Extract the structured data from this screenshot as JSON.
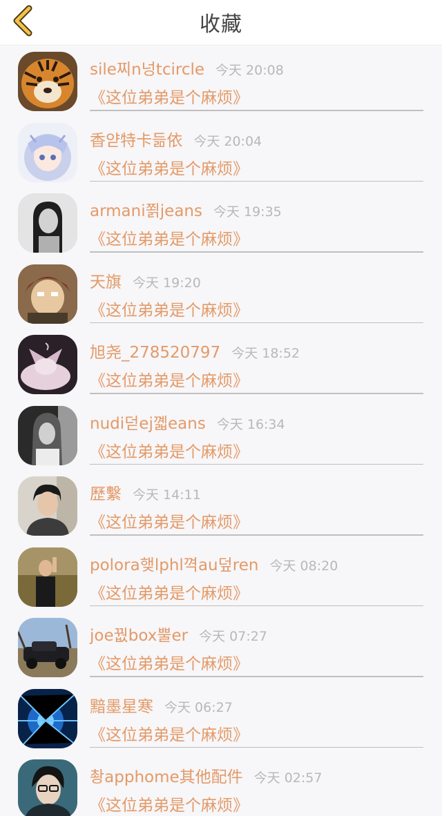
{
  "header": {
    "title": "收藏",
    "back_icon": "chevron-left-icon",
    "back_color": "#f2c14e"
  },
  "accent_color": "#e39a68",
  "items": [
    {
      "name": "sile찌n넝tcircle",
      "time": "今天 20:08",
      "book": "《这位弟弟是个麻烦》",
      "avatar": "tiger"
    },
    {
      "name": "香얃特卡듦依",
      "time": "今天 20:04",
      "book": "《这位弟弟是个麻烦》",
      "avatar": "anime-girl"
    },
    {
      "name": "armani쬙jeans",
      "time": "今天 19:35",
      "book": "《这位弟弟是个麻烦》",
      "avatar": "woman-bw"
    },
    {
      "name": "天旗",
      "time": "今天 19:20",
      "book": "《这位弟弟是个麻烦》",
      "avatar": "anime-boy"
    },
    {
      "name": "旭尧_278520797",
      "time": "今天 18:52",
      "book": "《这位弟弟是个麻烦》",
      "avatar": "anime-cat"
    },
    {
      "name": "nudi덛ej꼛eans",
      "time": "今天 16:34",
      "book": "《这位弟弟是个麻烦》",
      "avatar": "girl-bw"
    },
    {
      "name": "歷繫",
      "time": "今天 14:11",
      "book": "《这位弟弟是个麻烦》",
      "avatar": "young-man"
    },
    {
      "name": "polora햊lphl껵au덮ren",
      "time": "今天 08:20",
      "book": "《这位弟弟是个麻烦》",
      "avatar": "person-gesture"
    },
    {
      "name": "joe꿦box뿔er",
      "time": "今天 07:27",
      "book": "《这位弟弟是个麻烦》",
      "avatar": "vintage-car"
    },
    {
      "name": "黯墨星寒",
      "time": "今天 06:27",
      "book": "《这位弟弟是个麻烦》",
      "avatar": "blue-abstract"
    },
    {
      "name": "촹apphome其他配件",
      "time": "今天 02:57",
      "book": "《这位弟弟是个麻烦》",
      "avatar": "man-glasses"
    }
  ]
}
